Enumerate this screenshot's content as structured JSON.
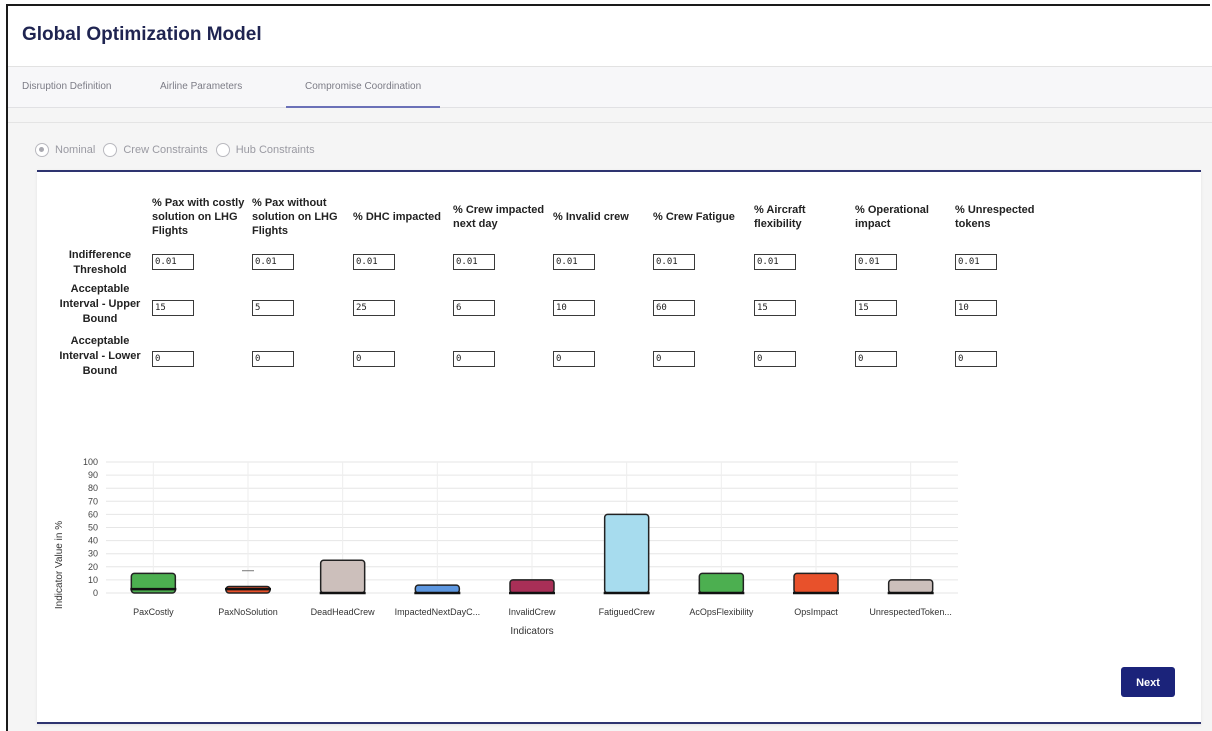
{
  "app": {
    "title": "Global Optimization Model"
  },
  "tabs": [
    {
      "label": "Disruption Definition",
      "active": false
    },
    {
      "label": "Airline Parameters",
      "active": false
    },
    {
      "label": "Compromise Coordination",
      "active": true
    }
  ],
  "radios": [
    {
      "label": "Nominal",
      "selected": true
    },
    {
      "label": "Crew Constraints",
      "selected": false
    },
    {
      "label": "Hub Constraints",
      "selected": false
    }
  ],
  "table": {
    "columns": [
      [
        "% Pax with costly",
        "solution on LHG",
        "Flights"
      ],
      [
        "% Pax without",
        "solution on LHG",
        "Flights"
      ],
      [
        "% DHC impacted"
      ],
      [
        "% Crew impacted",
        "next day"
      ],
      [
        "% Invalid crew"
      ],
      [
        "% Crew Fatigue"
      ],
      [
        "% Aircraft",
        "flexibility"
      ],
      [
        "% Operational",
        "impact"
      ],
      [
        "% Unrespected",
        "tokens"
      ]
    ],
    "rows": [
      {
        "label": [
          "Indifference",
          "Threshold"
        ],
        "values": [
          "0.01",
          "0.01",
          "0.01",
          "0.01",
          "0.01",
          "0.01",
          "0.01",
          "0.01",
          "0.01"
        ]
      },
      {
        "label": [
          "Acceptable",
          "Interval - Upper",
          "Bound"
        ],
        "values": [
          "15",
          "5",
          "25",
          "6",
          "10",
          "60",
          "15",
          "15",
          "10"
        ]
      },
      {
        "label": [
          "Acceptable",
          "Interval - Lower",
          "Bound"
        ],
        "values": [
          "0",
          "0",
          "0",
          "0",
          "0",
          "0",
          "0",
          "0",
          "0"
        ]
      }
    ]
  },
  "chart_data": {
    "type": "bar",
    "categories": [
      "PaxCostly",
      "PaxNoSolution",
      "DeadHeadCrew",
      "ImpactedNextDayC...",
      "InvalidCrew",
      "FatiguedCrew",
      "AcOpsFlexibility",
      "OpsImpact",
      "UnrespectedToken..."
    ],
    "series": [
      {
        "values": [
          15,
          5,
          25,
          6,
          10,
          60,
          15,
          15,
          10
        ]
      }
    ],
    "current_values": [
      3,
      3,
      0,
      0,
      0,
      0,
      0,
      0,
      0
    ],
    "annotations": [
      {
        "category": "PaxNoSolution",
        "marker_value": 17
      }
    ],
    "colors": [
      "#4caf50",
      "#e8512b",
      "#ccbfbb",
      "#5d97e0",
      "#a82f57",
      "#a7dcee",
      "#4caf50",
      "#e8512b",
      "#ccbfbb"
    ],
    "xlabel": "Indicators",
    "ylabel": "Indicator Value in %",
    "ylim": [
      0,
      100
    ],
    "yticks": [
      0,
      10,
      20,
      30,
      40,
      50,
      60,
      70,
      80,
      90,
      100
    ],
    "grid": true
  },
  "buttons": {
    "next": "Next"
  }
}
